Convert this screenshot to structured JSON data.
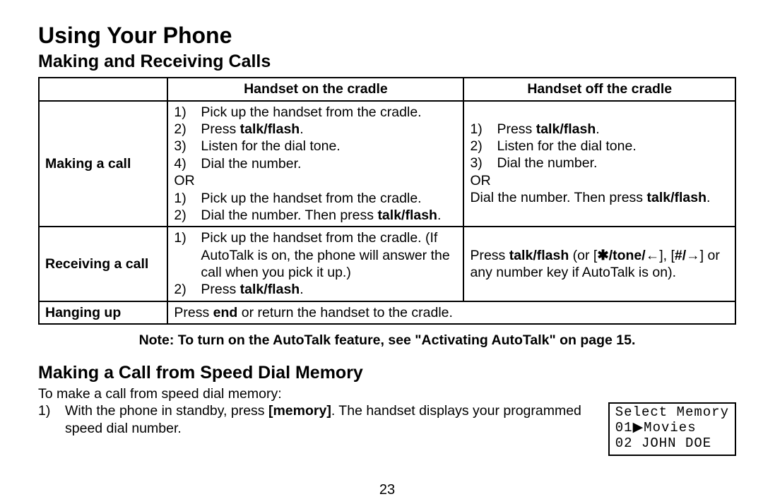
{
  "title": "Using Your Phone",
  "section1": "Making and Receiving Calls",
  "table": {
    "header_empty": "",
    "header_on": "Handset on the cradle",
    "header_off": "Handset off the cradle",
    "rows": {
      "making": {
        "label": "Making a call",
        "on_a": [
          "Pick up the handset from the cradle.",
          "Press ",
          "Listen for the dial tone.",
          "Dial the number."
        ],
        "or": "OR",
        "on_b": [
          "Pick up the handset from the cradle.",
          "Dial the number. Then press "
        ],
        "bold_talkflash": "talk/flash",
        "off_a": [
          "Press ",
          "Listen for the dial tone.",
          "Dial the number."
        ],
        "off_b": "Dial the number. Then press "
      },
      "receiving": {
        "label": "Receiving a call",
        "on": [
          "Pick up the handset from the cradle. (If AutoTalk is on, the phone will answer the call when you pick it up.)",
          "Press "
        ],
        "off_pre": "Press ",
        "off_mid1": " (or [",
        "off_sym1": "✱/tone/←",
        "off_mid2": "], [",
        "off_sym2": "#/→",
        "off_post": "] or any number key if AutoTalk is on)."
      },
      "hanging": {
        "label": "Hanging up",
        "text_pre": "Press ",
        "bold_end": "end",
        "text_post": " or return the handset to the cradle."
      }
    }
  },
  "note": "Note: To turn on the AutoTalk feature, see \"Activating AutoTalk\" on page 15.",
  "section2": "Making a Call from Speed Dial Memory",
  "intro": "To make a call from speed dial memory:",
  "step1_pre": "With the phone in standby, press ",
  "step1_bold": "[memory]",
  "step1_post": ". The handset displays your programmed speed dial number.",
  "lcd": {
    "line1": "Select Memory",
    "line2": "01▶Movies",
    "line3": "02 JOHN DOE"
  },
  "page": "23",
  "n": {
    "1": "1)",
    "2": "2)",
    "3": "3)",
    "4": "4)"
  }
}
